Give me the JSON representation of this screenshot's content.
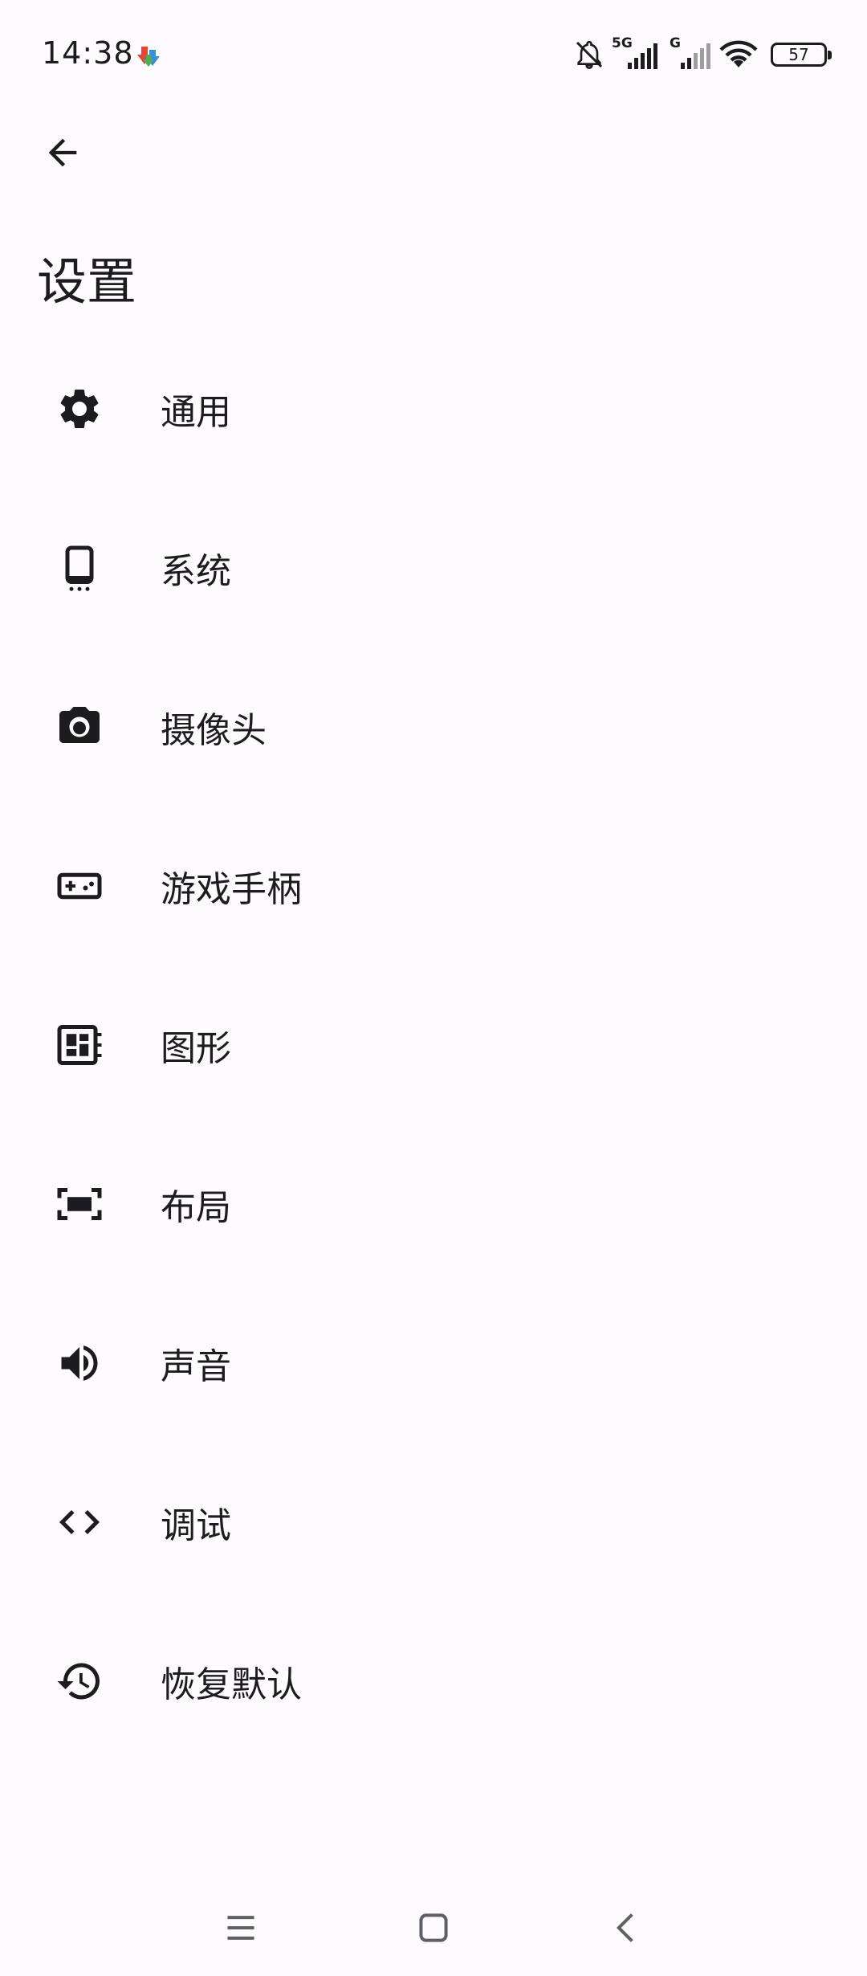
{
  "status_bar": {
    "time": "14:38",
    "battery_level": "57",
    "network_5g": "5G",
    "network_g": "G",
    "icons": [
      "app-notification-icon",
      "bell-off-icon",
      "signal-5g-icon",
      "signal-g-icon",
      "wifi-icon",
      "battery-icon"
    ]
  },
  "app_bar": {
    "back_icon": "arrow-back-icon",
    "title": "设置"
  },
  "settings": {
    "items": [
      {
        "label": "通用",
        "icon": "gear-icon"
      },
      {
        "label": "系统",
        "icon": "phone-icon"
      },
      {
        "label": "摄像头",
        "icon": "camera-icon"
      },
      {
        "label": "游戏手柄",
        "icon": "gamepad-icon"
      },
      {
        "label": "图形",
        "icon": "graphics-icon"
      },
      {
        "label": "布局",
        "icon": "layout-icon"
      },
      {
        "label": "声音",
        "icon": "volume-icon"
      },
      {
        "label": "调试",
        "icon": "code-icon"
      },
      {
        "label": "恢复默认",
        "icon": "restore-icon"
      }
    ]
  },
  "nav_bar": {
    "icons": [
      "menu-icon",
      "home-icon",
      "back-icon"
    ]
  },
  "colors": {
    "background": "#fdfbfe",
    "text": "#1c1b1f"
  }
}
